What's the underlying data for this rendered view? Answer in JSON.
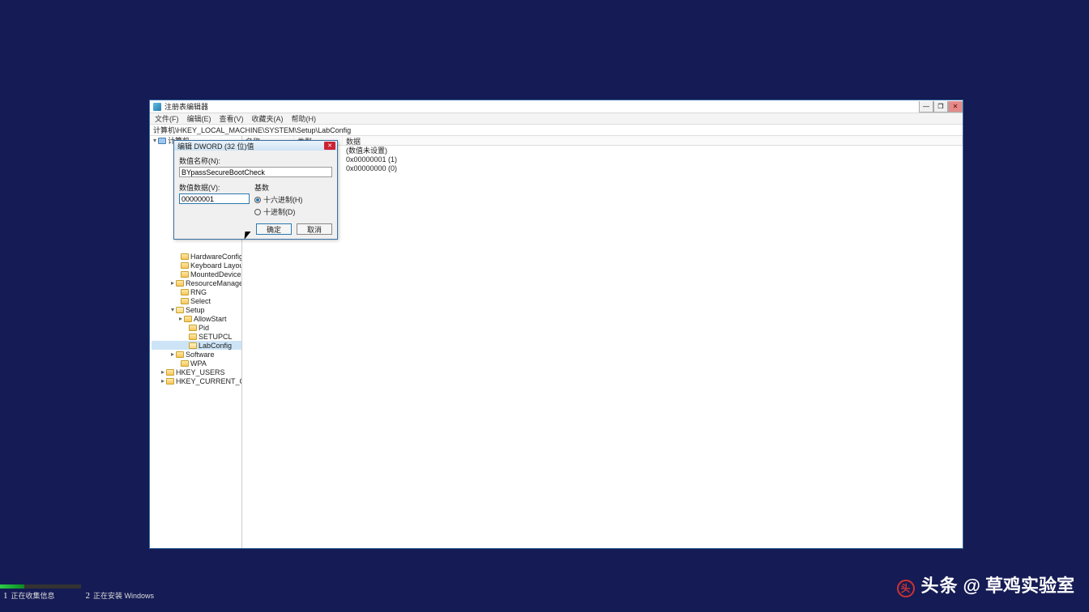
{
  "window": {
    "title": "注册表编辑器",
    "min": "—",
    "max": "❐",
    "close": "✕"
  },
  "menubar": {
    "file": "文件(F)",
    "edit": "编辑(E)",
    "view": "查看(V)",
    "fav": "收藏夹(A)",
    "help": "帮助(H)"
  },
  "address": "计算机\\HKEY_LOCAL_MACHINE\\SYSTEM\\Setup\\LabConfig",
  "tree": {
    "root": "计算机",
    "visible_below": {
      "n0": "HardwareConfig",
      "n1": "Keyboard Layout",
      "n2": "MountedDevices",
      "n3": "ResourceManager",
      "n4": "RNG",
      "n5": "Select",
      "n6": "Setup",
      "n6a": "AllowStart",
      "n6b": "Pid",
      "n6c": "SETUPCL",
      "n6d": "LabConfig",
      "n7": "Software",
      "n8": "WPA",
      "nhu": "HKEY_USERS",
      "nhcc": "HKEY_CURRENT_CONFIG"
    }
  },
  "list": {
    "headers": {
      "name": "名称",
      "type": "类型",
      "data": "数据"
    },
    "rows": {
      "r0": "(数值未设置)",
      "r1": "0x00000001 (1)",
      "r2": "0x00000000 (0)"
    }
  },
  "dialog": {
    "title": "编辑 DWORD (32 位)值",
    "name_label": "数值名称(N):",
    "name_value": "BYpassSecureBootCheck",
    "data_label": "数值数据(V):",
    "data_value": "00000001",
    "base_label": "基数",
    "radio_hex": "十六进制(H)",
    "radio_dec": "十进制(D)",
    "ok": "确定",
    "cancel": "取消"
  },
  "steps": {
    "s1_num": "1",
    "s1": "正在收集信息",
    "s2_num": "2",
    "s2": "正在安装 Windows"
  },
  "watermark": {
    "brand": "头条",
    "at": "@",
    "name": "草鸡实验室"
  }
}
